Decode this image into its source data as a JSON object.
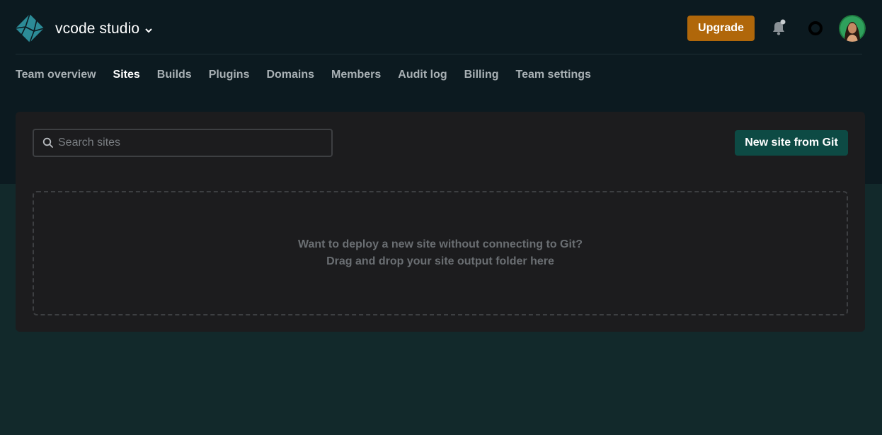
{
  "header": {
    "team_name": "vcode studio",
    "upgrade_label": "Upgrade",
    "icons": [
      "netlify-logo-icon",
      "chevron-down-icon",
      "bell-icon",
      "ring-icon",
      "avatar"
    ]
  },
  "nav": {
    "items": [
      {
        "label": "Team overview",
        "active": false
      },
      {
        "label": "Sites",
        "active": true
      },
      {
        "label": "Builds",
        "active": false
      },
      {
        "label": "Plugins",
        "active": false
      },
      {
        "label": "Domains",
        "active": false
      },
      {
        "label": "Members",
        "active": false
      },
      {
        "label": "Audit log",
        "active": false
      },
      {
        "label": "Billing",
        "active": false
      },
      {
        "label": "Team settings",
        "active": false
      }
    ]
  },
  "sites": {
    "search_placeholder": "Search sites",
    "search_value": "",
    "new_site_label": "New site from Git",
    "dropzone_line1": "Want to deploy a new site without connecting to Git?",
    "dropzone_line2": "Drag and drop your site output folder here"
  },
  "colors": {
    "upgrade": "#b0670a",
    "primary": "#0d4a44",
    "top_background": "#0c1a20",
    "page_background": "#12292b",
    "panel": "#1c1c1e"
  }
}
